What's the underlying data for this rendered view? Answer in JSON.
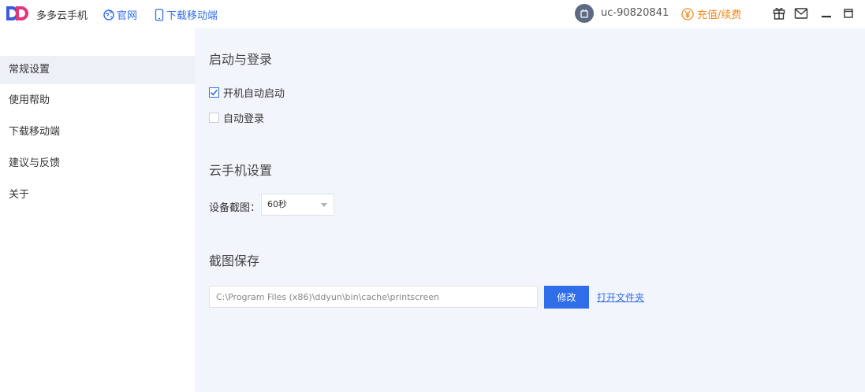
{
  "header": {
    "app_title": "多多云手机",
    "official_site": "官网",
    "download_mobile": "下载移动端",
    "username": "uc-90820841",
    "recharge": "充值/续费",
    "icons": [
      "gift-icon",
      "mail-icon",
      "minimize-icon",
      "maximize-icon"
    ]
  },
  "sidebar": {
    "items": [
      {
        "label": "常规设置",
        "active": true
      },
      {
        "label": "使用帮助",
        "active": false
      },
      {
        "label": "下载移动端",
        "active": false
      },
      {
        "label": "建议与反馈",
        "active": false
      },
      {
        "label": "关于",
        "active": false
      }
    ]
  },
  "main": {
    "startup": {
      "title": "启动与登录",
      "auto_start": {
        "label": "开机自动启动",
        "checked": true
      },
      "auto_login": {
        "label": "自动登录",
        "checked": false
      }
    },
    "cloud_phone": {
      "title": "云手机设置",
      "screenshot_label": "设备截图：",
      "screenshot_value": "60秒"
    },
    "save": {
      "title": "截图保存",
      "path": "C:\\Program Files (x86)\\ddyun\\bin\\cache\\printscreen",
      "modify_label": "修改",
      "open_folder_label": "打开文件夹"
    }
  },
  "colors": {
    "accent": "#2f6ee8",
    "recharge": "#f08a1e",
    "main_bg": "#f3f5fc",
    "active_bg": "#eef0f8"
  }
}
